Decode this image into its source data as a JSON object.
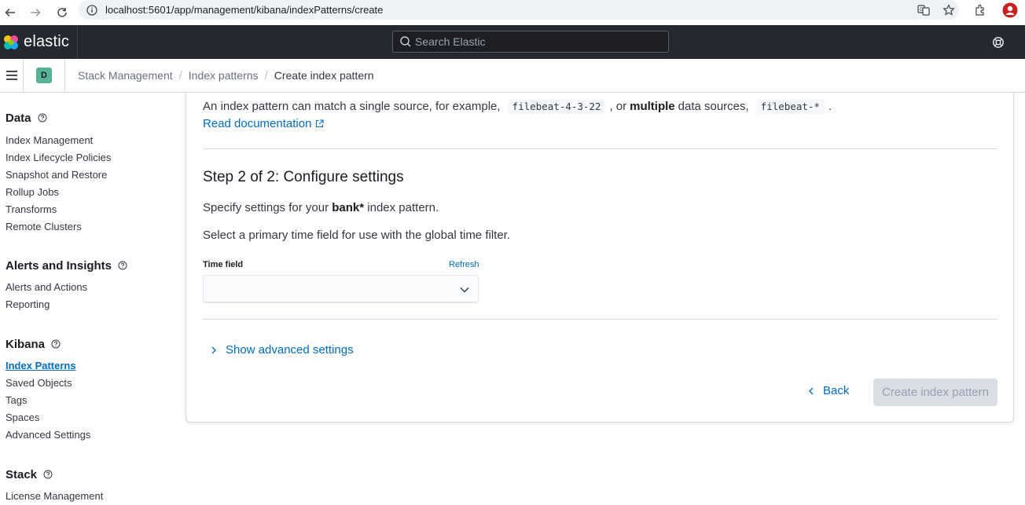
{
  "browser": {
    "url": "localhost:5601/app/management/kibana/indexPatterns/create"
  },
  "header": {
    "brand": "elastic",
    "search_placeholder": "Search Elastic"
  },
  "subheader": {
    "space_letter": "D",
    "breadcrumbs": [
      "Stack Management",
      "Index patterns",
      "Create index pattern"
    ]
  },
  "sidebar": {
    "groups": [
      {
        "title": "Data",
        "items": [
          "Index Management",
          "Index Lifecycle Policies",
          "Snapshot and Restore",
          "Rollup Jobs",
          "Transforms",
          "Remote Clusters"
        ]
      },
      {
        "title": "Alerts and Insights",
        "items": [
          "Alerts and Actions",
          "Reporting"
        ]
      },
      {
        "title": "Kibana",
        "items": [
          "Index Patterns",
          "Saved Objects",
          "Tags",
          "Spaces",
          "Advanced Settings"
        ]
      },
      {
        "title": "Stack",
        "items": [
          "License Management"
        ]
      }
    ]
  },
  "main": {
    "intro_1": "An index pattern can match a single source, for example,",
    "intro_code_1": "filebeat-4-3-22",
    "intro_2": ", or",
    "intro_bold": "multiple",
    "intro_3": "data sources,",
    "intro_code_2": "filebeat-*",
    "intro_4": ".",
    "doc_link": "Read documentation",
    "step_title": "Step 2 of 2: Configure settings",
    "spec_1": "Specify settings for your",
    "spec_bold": "bank*",
    "spec_2": "index pattern.",
    "select_text": "Select a primary time field for use with the global time filter.",
    "time_field_label": "Time field",
    "refresh_label": "Refresh",
    "time_field_value": "",
    "advanced_label": "Show advanced settings",
    "back_label": "Back",
    "create_label": "Create index pattern"
  },
  "colors": {
    "accent": "#006bb8",
    "header_bg": "#25282f",
    "space_avatar": "#54b399",
    "disabled_btn": "#d8dde6"
  }
}
